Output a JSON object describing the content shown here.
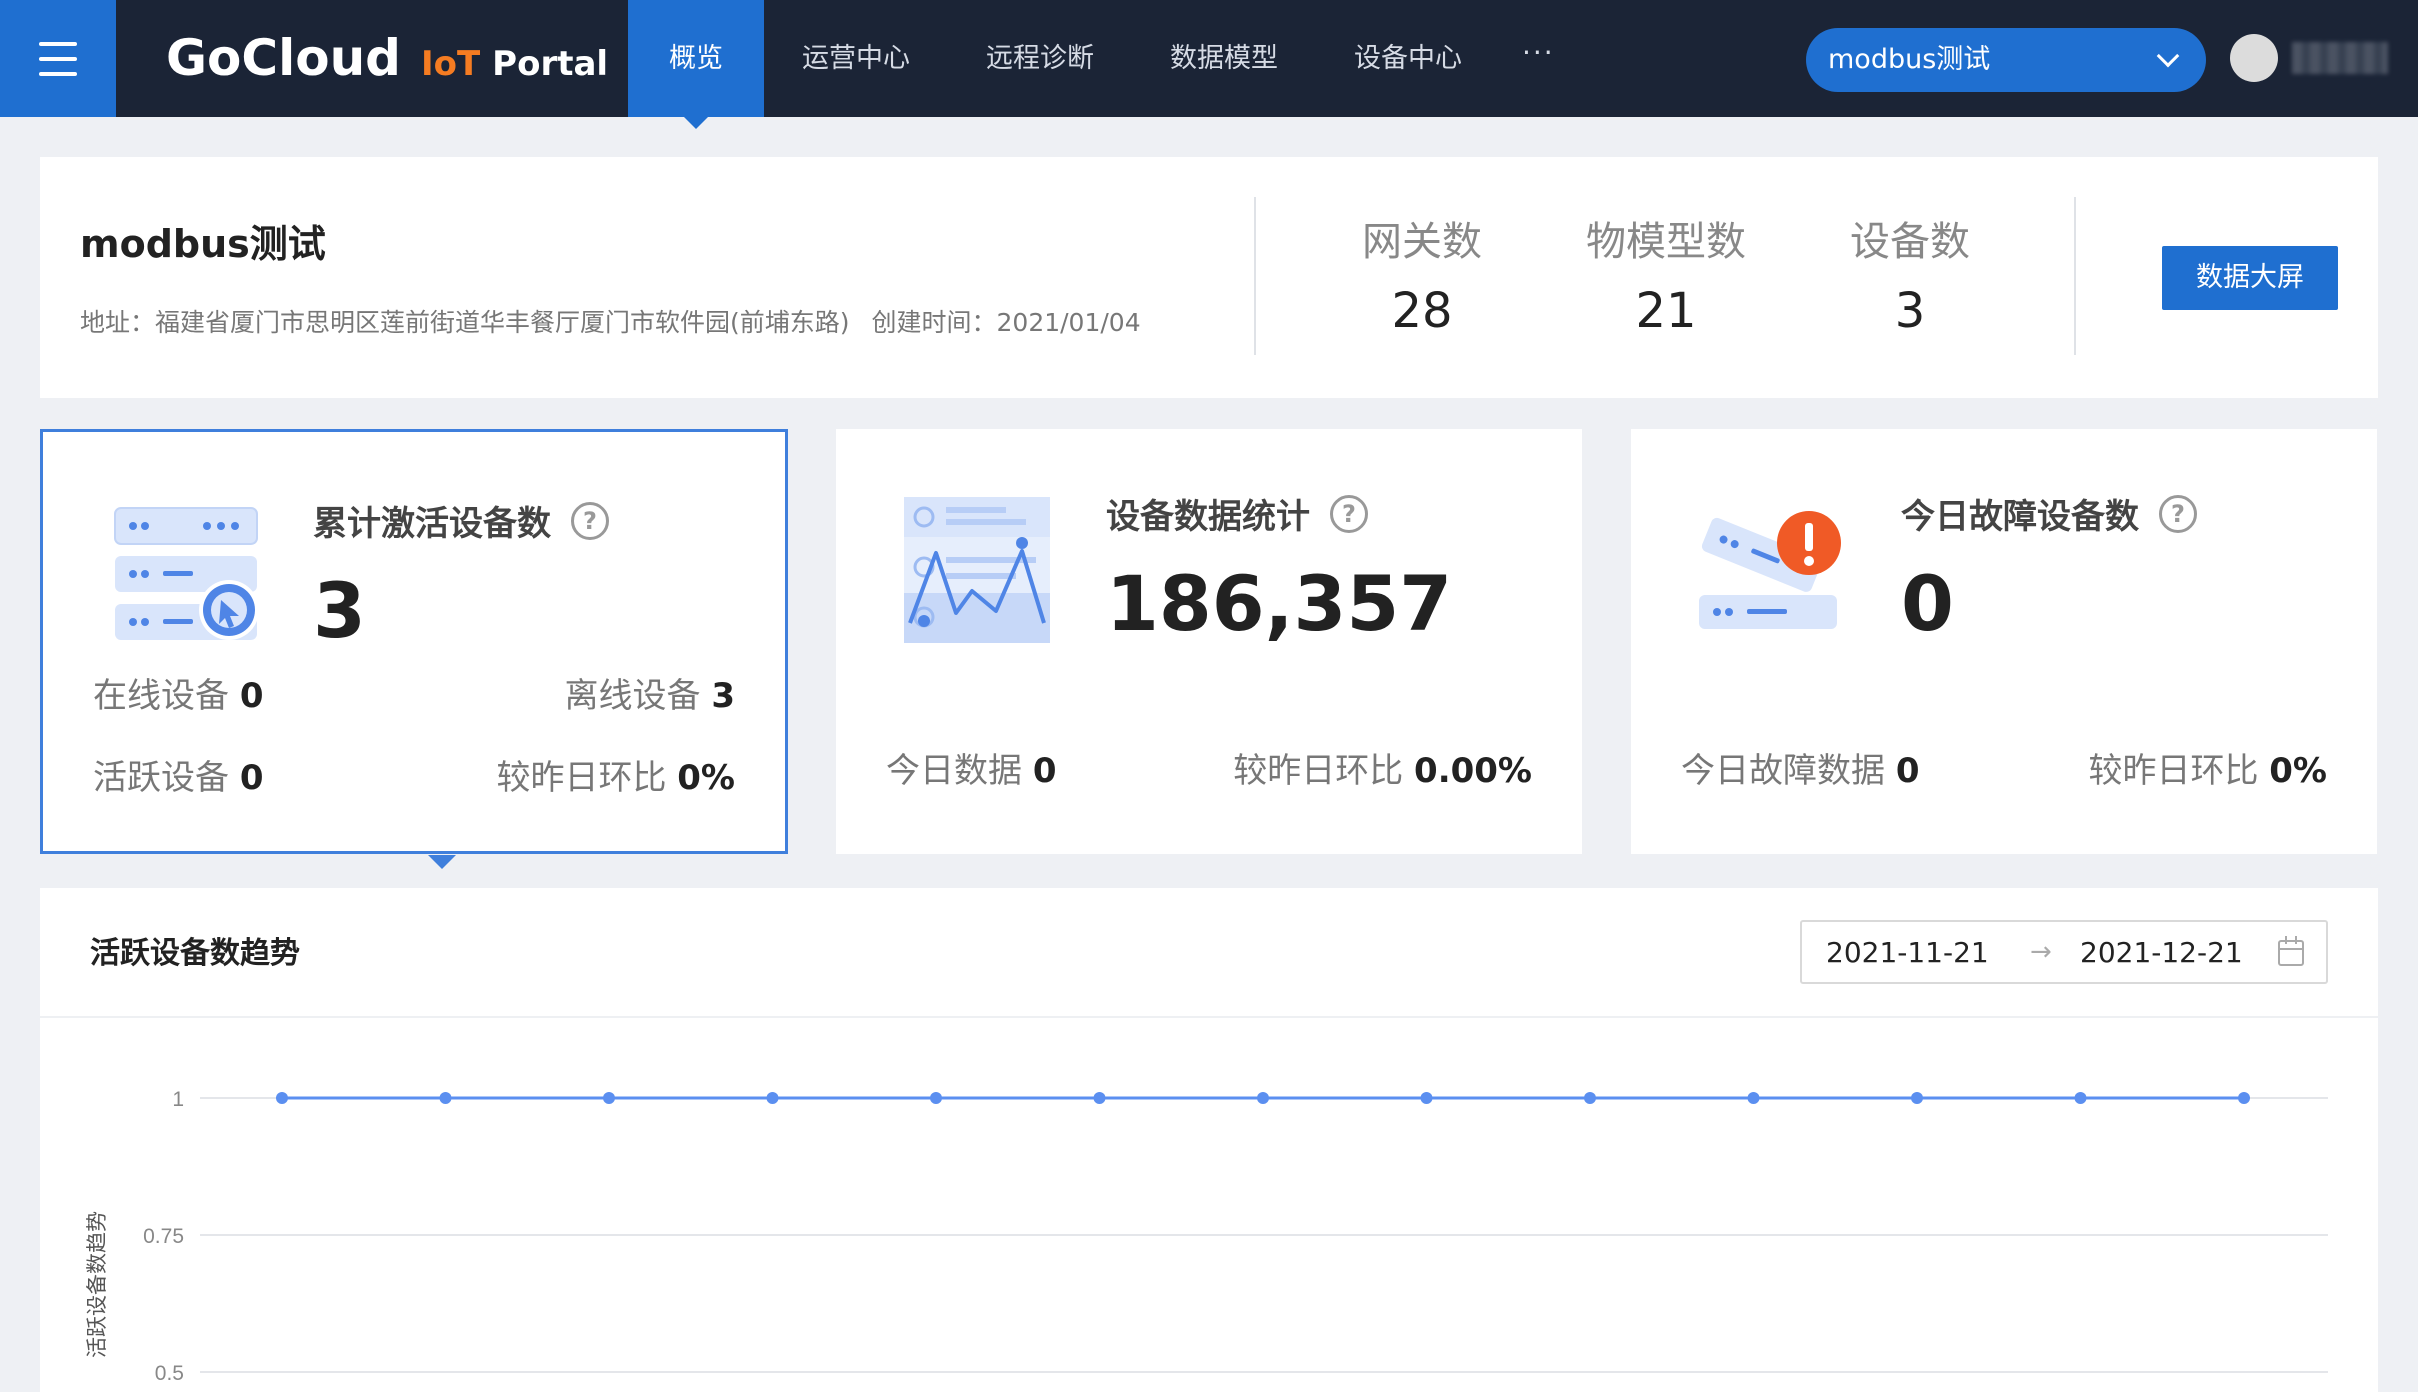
{
  "header": {
    "logo_main": "GoCloud",
    "logo_iot": "IoT",
    "logo_portal": "Portal",
    "nav": [
      "概览",
      "运营中心",
      "远程诊断",
      "数据模型",
      "设备中心"
    ],
    "nav_more": "···",
    "project_selector": "modbus测试"
  },
  "project": {
    "name": "modbus测试",
    "address": "地址：福建省厦门市思明区莲前街道华丰餐厅厦门市软件园(前埔东路)",
    "created": "创建时间：2021/01/04",
    "stats": [
      {
        "label": "网关数",
        "value": "28"
      },
      {
        "label": "物模型数",
        "value": "21"
      },
      {
        "label": "设备数",
        "value": "3"
      }
    ],
    "big_screen_label": "数据大屏"
  },
  "metrics": {
    "activated": {
      "title": "累计激活设备数",
      "value": "3",
      "online_label": "在线设备",
      "online_value": "0",
      "offline_label": "离线设备",
      "offline_value": "3",
      "active_label": "活跃设备",
      "active_value": "0",
      "compare_label": "较昨日环比",
      "compare_value": "0%"
    },
    "data_stats": {
      "title": "设备数据统计",
      "value": "186,357",
      "today_label": "今日数据",
      "today_value": "0",
      "compare_label": "较昨日环比",
      "compare_value": "0.00%"
    },
    "faults": {
      "title": "今日故障设备数",
      "value": "0",
      "today_label": "今日故障数据",
      "today_value": "0",
      "compare_label": "较昨日环比",
      "compare_value": "0%"
    }
  },
  "trend": {
    "title": "活跃设备数趋势",
    "date_start": "2021-11-21",
    "date_arrow": "→",
    "date_end": "2021-12-21"
  },
  "colors": {
    "accent": "#1f6fd0",
    "topbar": "#1b2436",
    "orange": "#f57c22",
    "line": "#5b8ff0"
  },
  "chart_data": {
    "type": "line",
    "ylabel": "活跃设备数趋势",
    "y_ticks": [
      "1",
      "0.75",
      "0.5"
    ],
    "ylim": [
      0.5,
      1
    ],
    "series": [
      {
        "values": [
          1,
          1,
          1,
          1,
          1,
          1,
          1,
          1,
          1,
          1,
          1,
          1,
          1
        ]
      }
    ],
    "grid": true
  }
}
